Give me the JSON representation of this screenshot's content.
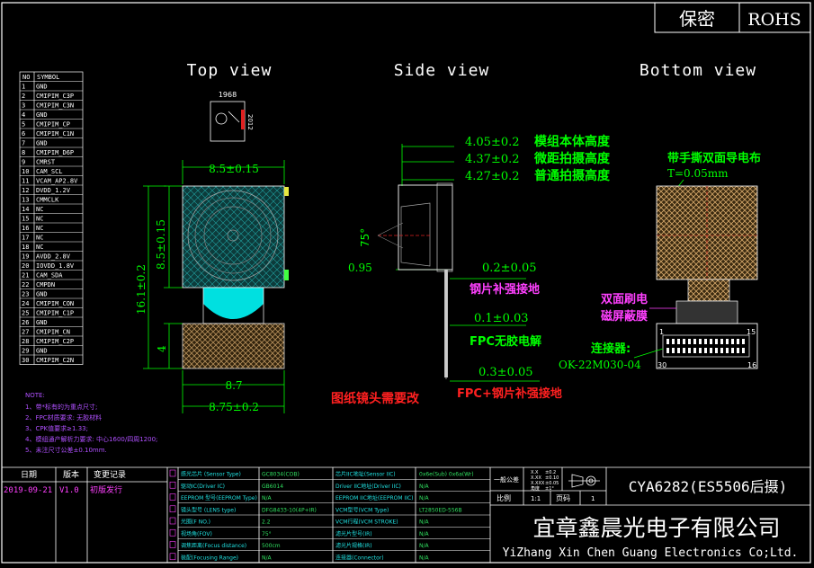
{
  "colors": {
    "background": "#000000",
    "line": "#ffffff",
    "dimension": "#00ff00",
    "title": "#ffffff",
    "annotation_red": "#ff2020",
    "annotation_magenta": "#ff40ff",
    "lens_cyan": "#00e0e0",
    "sensor_fill": "#1a8a8a",
    "mesh": "#d6a86a",
    "block_yellow": "#d8d850",
    "fpc_gray": "#7a7a7a",
    "note_purple": "#b050ff",
    "table_cyan": "#20e0e0",
    "table_green": "#30e060"
  },
  "header": {
    "confidential": "保密",
    "rohs": "ROHS"
  },
  "views": {
    "top": "Top view",
    "side": "Side view",
    "bottom": "Bottom view"
  },
  "pin_table": {
    "headers": [
      "NO",
      "SYMBOL"
    ],
    "rows": [
      [
        "1",
        "GND"
      ],
      [
        "2",
        "CMIPIM_C3P"
      ],
      [
        "3",
        "CMIPIM_C3N"
      ],
      [
        "4",
        "GND"
      ],
      [
        "5",
        "CMIPIM_CP"
      ],
      [
        "6",
        "CMIPIM_C1N"
      ],
      [
        "7",
        "GND"
      ],
      [
        "8",
        "CMIPIM_D6P"
      ],
      [
        "9",
        "CMRST"
      ],
      [
        "10",
        "CAM_SCL"
      ],
      [
        "11",
        "VCAM_AP2.8V"
      ],
      [
        "12",
        "DVDD_1.2V"
      ],
      [
        "13",
        "CMMCLK"
      ],
      [
        "14",
        "NC"
      ],
      [
        "15",
        "NC"
      ],
      [
        "16",
        "NC"
      ],
      [
        "17",
        "NC"
      ],
      [
        "18",
        "NC"
      ],
      [
        "19",
        "AVDD_2.8V"
      ],
      [
        "20",
        "IOVDD_1.8V"
      ],
      [
        "21",
        "CAM_SDA"
      ],
      [
        "22",
        "CMPDN"
      ],
      [
        "23",
        "GND"
      ],
      [
        "24",
        "CMIPIM_CON"
      ],
      [
        "25",
        "CMIPIM_C1P"
      ],
      [
        "26",
        "GND"
      ],
      [
        "27",
        "CMIPIM_CN"
      ],
      [
        "28",
        "CMIPIM_C2P"
      ],
      [
        "29",
        "GND"
      ],
      [
        "30",
        "CMIPIM_C2N"
      ]
    ]
  },
  "top_view": {
    "chip_top": "1968",
    "chip_side": "2012",
    "width_dim": "8.5±0.15",
    "module_height_dim": "8.5±0.15",
    "total_length_dim": "16.1±0.2",
    "fpc_length_dim": "4",
    "fpc_width_dim": "8.7",
    "fpc_width2_dim": "8.75±0.2"
  },
  "side_view": {
    "h1": "4.05±0.2",
    "h1_note": "模组本体高度",
    "h2": "4.37±0.2",
    "h2_note": "微距拍摄高度",
    "h3": "4.27±0.2",
    "h3_note": "普通拍摄高度",
    "angle": "75°",
    "thickness": "0.95",
    "steel_dim": "0.2±0.05",
    "steel_note": "钢片补强接地",
    "fpc_dim": "0.1±0.03",
    "fpc_note": "FPC无胶电解",
    "fpc_steel_dim": "0.3±0.05",
    "fpc_steel_note": "FPC+钢片补强接地",
    "lens_note": "图纸镜头需要改"
  },
  "bottom_view": {
    "tape_note": "带手撕双面导电布",
    "tape_thickness": "T=0.05mm",
    "shield_note1": "双面刷电",
    "shield_note2": "磁屏蔽膜",
    "connector_label": "连接器:",
    "connector_part": "OK-22M030-04",
    "pin_1": "1",
    "pin_15": "15",
    "pin_30": "30",
    "pin_16": "16"
  },
  "notes": {
    "title": "NOTE:",
    "lines": [
      "1、带*标有的为重点尺寸;",
      "2、FPC材质要求: 无胶材料",
      "3、CPK值要求≥1.33;",
      "4、模组通产解析力要求: 中心1600/四周1200;",
      "5、未注尺寸公差±0.10mm."
    ]
  },
  "revision": {
    "headers": [
      "日期",
      "版本",
      "变更记录"
    ],
    "row": [
      "2019-09-21",
      "V1.0",
      "初版发行"
    ]
  },
  "spec_table": {
    "left_labels": [
      "感光芯片 (Sensor Type)",
      "驱动IC(Driver IC)",
      "EEPROM 型号(EEPROM Type)",
      "镜头型号 (LENS type)",
      "光圈(F NO.)",
      "视场角(FOV)",
      "调焦距离(Focus distance)",
      "装配(Focusing Range)"
    ],
    "left_values": [
      "GC8034(COB)",
      "GB6014",
      "N/A",
      "DFG8433-10(4P+IR)",
      "2.2",
      "75°",
      "500cm",
      "N/A"
    ],
    "mid_labels": [
      "芯片IIC地址(Sensor IIC)",
      "Driver IIC地址(Driver IIC)",
      "EEPROM IIC地址(EEPROM IIC)",
      "VCM型号(VCM Type)",
      "VCM行程(VCM STROKE)",
      "滤光片型号(IR)",
      "滤光片规格(IR)",
      "连接器(Connector)"
    ],
    "mid_values": [
      "0x6e(Sub) 0x6a(Wr)",
      "N/A",
      "N/A",
      "LT2850ED-556B",
      "N/A",
      "N/A",
      "N/A",
      "N/A"
    ]
  },
  "title_block": {
    "tolerance_label": "一般公差",
    "tolerance_rows": [
      "X.X",
      "X.XX",
      "X.XXX",
      "角度"
    ],
    "tolerance_values": [
      "±0.2",
      "±0.10",
      "±0.05",
      "±1°"
    ],
    "projection_icon": "first-angle-projection-icon",
    "scale_label": "比例",
    "scale_value": "1:1",
    "page_label": "页码",
    "page_value": "1",
    "part_name": "CYA6282(ES5506后摄)",
    "company_cn": "宜章鑫晨光电子有限公司",
    "company_en": "YiZhang Xin Chen Guang Electronics Co;Ltd."
  }
}
